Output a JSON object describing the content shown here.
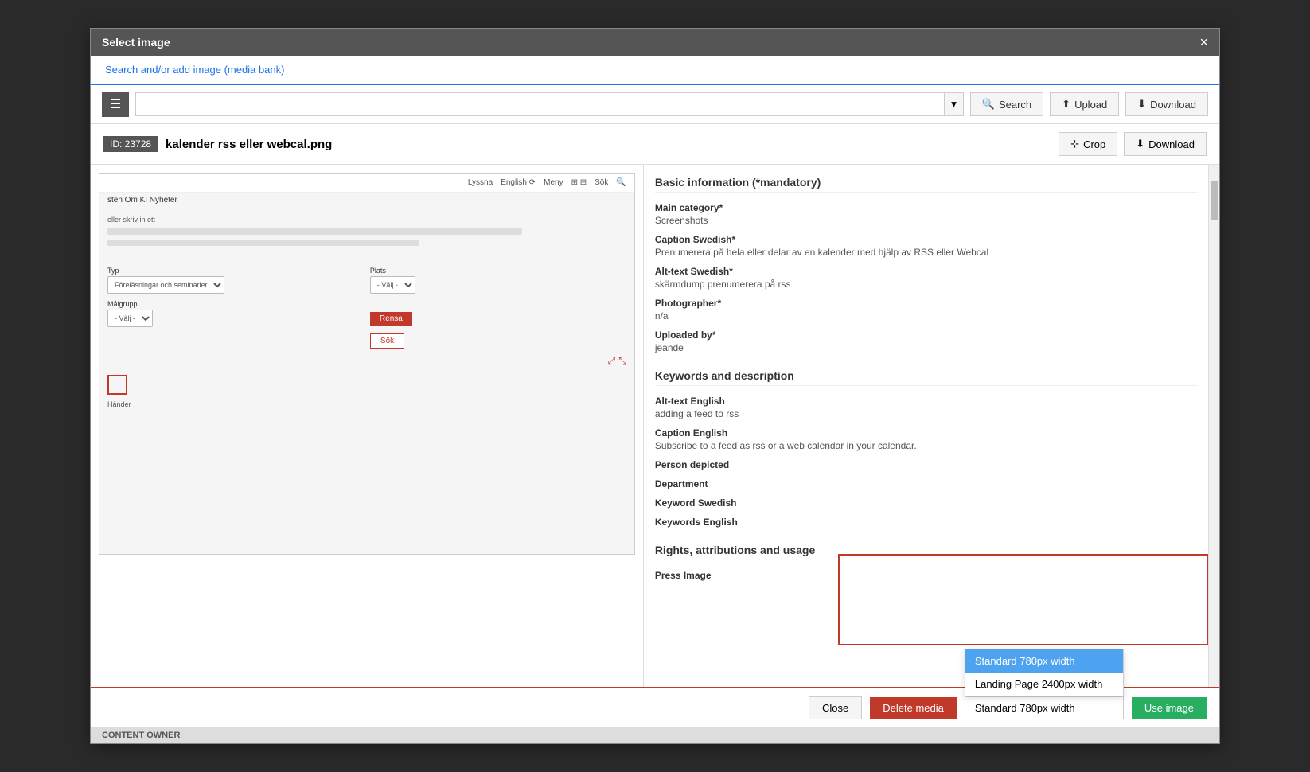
{
  "modal": {
    "title": "Select image",
    "close_label": "×"
  },
  "tabs": {
    "active_tab": "Search and/or add image (media bank)"
  },
  "toolbar": {
    "menu_icon": "☰",
    "search_placeholder": "",
    "dropdown_label": "▾",
    "search_label": "Search",
    "upload_label": "Upload",
    "download_label": "Download"
  },
  "image_info": {
    "id_label": "ID: 23728",
    "filename": "kalender rss eller webcal.png",
    "crop_label": "Crop",
    "download_label": "Download"
  },
  "basic_info": {
    "section_title": "Basic information (*mandatory)",
    "fields": [
      {
        "label": "Main category*",
        "value": "Screenshots"
      },
      {
        "label": "Caption Swedish*",
        "value": "Prenumerera på hela eller delar av en kalender med hjälp av RSS eller Webcal"
      },
      {
        "label": "Alt-text Swedish*",
        "value": "skärmdump prenumerera på rss"
      },
      {
        "label": "Photographer*",
        "value": "n/a"
      },
      {
        "label": "Uploaded by*",
        "value": "jeande"
      }
    ]
  },
  "keywords_info": {
    "section_title": "Keywords and description",
    "fields": [
      {
        "label": "Alt-text English",
        "value": "adding a feed to rss"
      },
      {
        "label": "Caption English",
        "value": "Subscribe to a feed as rss or a web calendar in your calendar."
      },
      {
        "label": "Person depicted",
        "value": ""
      },
      {
        "label": "Department",
        "value": ""
      },
      {
        "label": "Keyword Swedish",
        "value": ""
      },
      {
        "label": "Keywords English",
        "value": ""
      }
    ]
  },
  "rights_info": {
    "section_title": "Rights, attributions and usage",
    "fields": [
      {
        "label": "Press Image",
        "value": ""
      }
    ]
  },
  "footer": {
    "close_label": "Close",
    "delete_label": "Delete media",
    "use_label": "Use image",
    "dropdown_options": [
      {
        "label": "Standard 780px width",
        "selected": true
      },
      {
        "label": "Landing Page 2400px width",
        "selected": false
      }
    ],
    "selected_option": "Standard 780px width"
  },
  "mock_ui": {
    "nav_items": [
      "Lyssna",
      "English",
      "⟳",
      "Meny",
      "⊞",
      "⊟",
      "Sök",
      "🔍"
    ],
    "breadcrumb": "sten  Om KI Nyheter",
    "form_label1": "Typ",
    "form_label2": "Plats",
    "form_select1": "Föreläsningar och seminarier",
    "form_select2": "- Välj -",
    "form_label3": "Målgrupp",
    "form_select3": "- Välj -",
    "form_btn1": "Rensa",
    "form_btn2": "Sök",
    "footer_text": "Händer"
  },
  "content_owner": "CONTENT OWNER"
}
